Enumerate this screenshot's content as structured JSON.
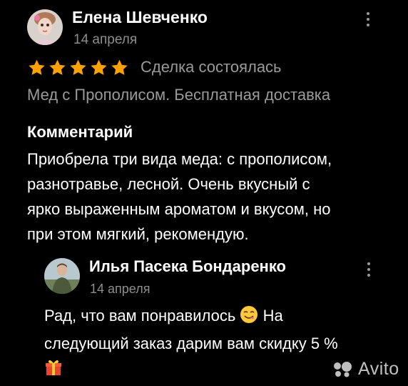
{
  "review": {
    "author": "Елена Шевченко",
    "date": "14 апреля",
    "rating": 5,
    "status": "Сделка состоялась",
    "product": "Мед с Прополисом. Бесплатная доставка",
    "comment_heading": "Комментарий",
    "comment_lines": [
      "Приобрела три вида меда: с прополисом,",
      "разнотравье, лесной.  Очень вкусный  с",
      "ярко выраженным ароматом и вкусом, но",
      "при этом мягкий, рекомендую."
    ]
  },
  "reply": {
    "author": "Илья Пасека Бондаренко",
    "date": "14 апреля",
    "line1": "Рад, что вам понравилось",
    "line1_end": " На",
    "line2": "следующий заказ дарим вам скидку 5 %"
  },
  "watermark": {
    "text": "Avito"
  },
  "colors": {
    "star": "#ffa200",
    "background": "#000000",
    "muted": "#8d8d8d"
  },
  "icons": [
    "avatar-doll",
    "avatar-man",
    "star-icon",
    "kebab-menu-icon",
    "yum-face-emoji",
    "gift-emoji",
    "avito-logo"
  ]
}
